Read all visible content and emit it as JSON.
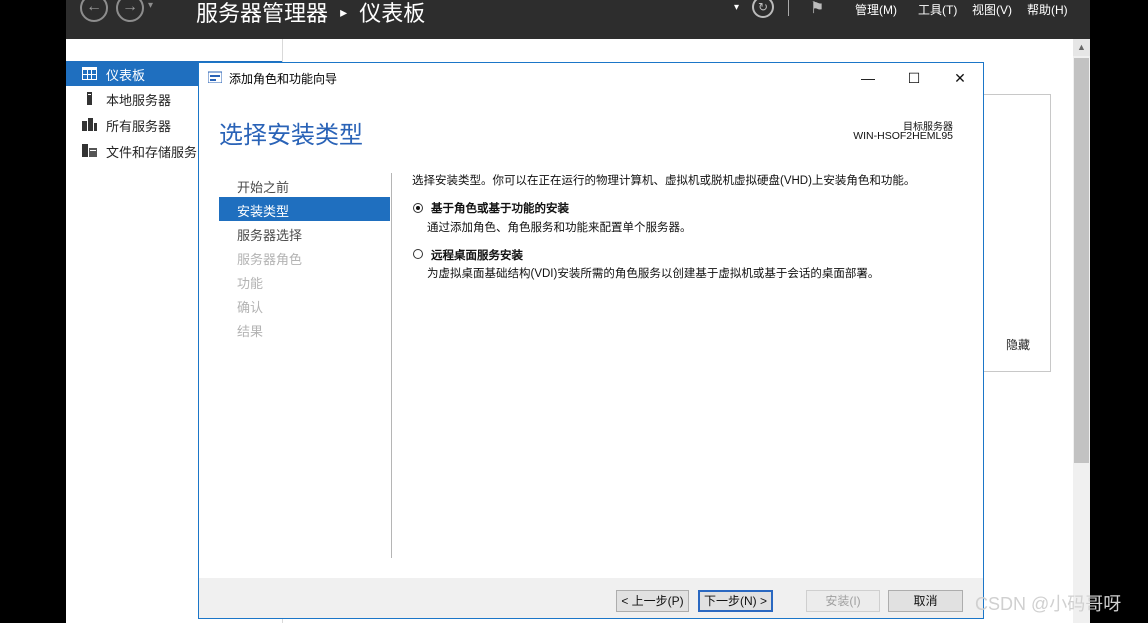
{
  "server_manager": {
    "title": "服务器管理器",
    "breadcrumb_sep": "▸",
    "page": "仪表板",
    "menus": [
      "管理(M)",
      "工具(T)",
      "视图(V)",
      "帮助(H)"
    ]
  },
  "sidebar": {
    "items": [
      {
        "label": "仪表板",
        "icon": "dashboard-icon",
        "active": true
      },
      {
        "label": "本地服务器",
        "icon": "server-icon",
        "active": false
      },
      {
        "label": "所有服务器",
        "icon": "servers-icon",
        "active": false
      },
      {
        "label": "文件和存储服务",
        "icon": "storage-icon",
        "active": false
      }
    ]
  },
  "background": {
    "hide_label": "隐藏"
  },
  "wizard": {
    "title": "添加角色和功能向导",
    "heading": "选择安装类型",
    "target_label": "目标服务器",
    "target_value": "WIN-HSOF2HEML95",
    "steps": [
      {
        "label": "开始之前",
        "state": "normal"
      },
      {
        "label": "安装类型",
        "state": "active"
      },
      {
        "label": "服务器选择",
        "state": "normal"
      },
      {
        "label": "服务器角色",
        "state": "disabled"
      },
      {
        "label": "功能",
        "state": "disabled"
      },
      {
        "label": "确认",
        "state": "disabled"
      },
      {
        "label": "结果",
        "state": "disabled"
      }
    ],
    "intro": "选择安装类型。你可以在正在运行的物理计算机、虚拟机或脱机虚拟硬盘(VHD)上安装角色和功能。",
    "options": [
      {
        "title": "基于角色或基于功能的安装",
        "desc": "通过添加角色、角色服务和功能来配置单个服务器。",
        "checked": true
      },
      {
        "title": "远程桌面服务安装",
        "desc": "为虚拟桌面基础结构(VDI)安装所需的角色服务以创建基于虚拟机或基于会话的桌面部署。",
        "checked": false
      }
    ],
    "buttons": {
      "prev": "< 上一步(P)",
      "next": "下一步(N) >",
      "install": "安装(I)",
      "cancel": "取消"
    },
    "window_controls": {
      "minimize": "—",
      "maximize": "☐",
      "close": "✕"
    }
  },
  "watermark": "CSDN @小码哥呀",
  "colors": {
    "accent": "#1f6fbf",
    "heading": "#2a63b7",
    "header_bg": "#2d2d2d"
  }
}
